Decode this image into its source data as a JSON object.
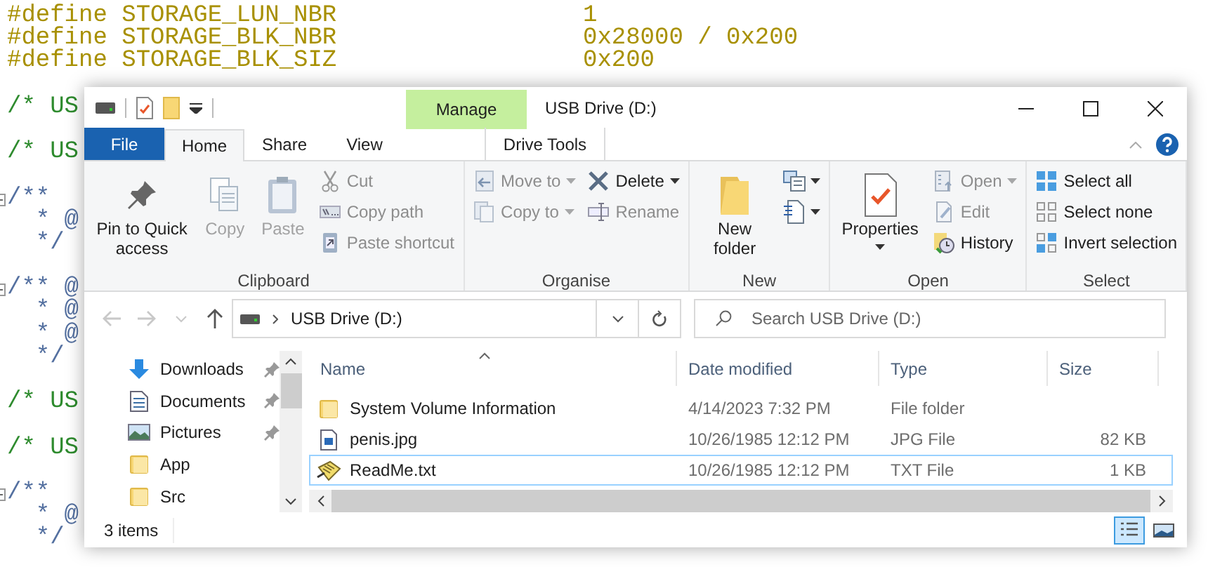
{
  "editor": {
    "lines": [
      {
        "kind": "define",
        "text": "#define STORAGE_LUN_NBR",
        "value": "1"
      },
      {
        "kind": "define",
        "text": "#define STORAGE_BLK_NBR",
        "value": "0x28000 / 0x200"
      },
      {
        "kind": "define",
        "text": "#define STORAGE_BLK_SIZ",
        "value": "0x200"
      },
      {
        "kind": "blank"
      },
      {
        "kind": "comment",
        "text": "/* US"
      },
      {
        "kind": "blank"
      },
      {
        "kind": "comment",
        "text": "/* US"
      },
      {
        "kind": "blank"
      },
      {
        "kind": "doc",
        "text": "/**",
        "fold": true
      },
      {
        "kind": "doc",
        "text": "  * @",
        "fold": false
      },
      {
        "kind": "doc",
        "text": "  */",
        "fold": false
      },
      {
        "kind": "blank"
      },
      {
        "kind": "doc",
        "text": "/** @",
        "fold": true
      },
      {
        "kind": "doc",
        "text": "  * @",
        "fold": false
      },
      {
        "kind": "doc",
        "text": "  * @",
        "fold": false
      },
      {
        "kind": "doc",
        "text": "  */",
        "fold": false
      },
      {
        "kind": "blank"
      },
      {
        "kind": "comment",
        "text": "/* US"
      },
      {
        "kind": "blank"
      },
      {
        "kind": "comment",
        "text": "/* US"
      },
      {
        "kind": "blank"
      },
      {
        "kind": "doc",
        "text": "/**",
        "fold": true
      },
      {
        "kind": "doc",
        "text": "  * @",
        "fold": false
      },
      {
        "kind": "doc",
        "text": "  */",
        "fold": false
      }
    ]
  },
  "window": {
    "title": "USB Drive (D:)",
    "context_tab": "Manage"
  },
  "tabs": [
    {
      "label": "File",
      "kind": "file",
      "selected": false
    },
    {
      "label": "Home",
      "kind": "tab",
      "selected": true
    },
    {
      "label": "Share",
      "kind": "tab",
      "selected": false
    },
    {
      "label": "View",
      "kind": "tab",
      "selected": false
    },
    {
      "label": "Drive Tools",
      "kind": "context",
      "selected": false
    }
  ],
  "ribbon": {
    "groups": [
      {
        "label": "Clipboard",
        "columns": [
          [
            {
              "kind": "large",
              "label": "Pin to Quick access",
              "disabled": false
            }
          ],
          [
            {
              "kind": "large",
              "label": "Copy",
              "disabled": true
            }
          ],
          [
            {
              "kind": "large",
              "label": "Paste",
              "disabled": true
            }
          ],
          [
            {
              "kind": "small",
              "label": "Cut",
              "disabled": true
            },
            {
              "kind": "small",
              "label": "Copy path",
              "disabled": true
            },
            {
              "kind": "small",
              "label": "Paste shortcut",
              "disabled": true
            }
          ]
        ]
      },
      {
        "label": "Organise",
        "columns": [
          [
            {
              "kind": "small",
              "label": "Move to",
              "disabled": true,
              "dropdown": true
            },
            {
              "kind": "small",
              "label": "Copy to",
              "disabled": true,
              "dropdown": true
            }
          ],
          [
            {
              "kind": "small",
              "label": "Delete",
              "disabled": false,
              "dropdown": true
            },
            {
              "kind": "small",
              "label": "Rename",
              "disabled": true
            }
          ]
        ]
      },
      {
        "label": "New",
        "columns": [
          [
            {
              "kind": "large",
              "label": "New folder",
              "disabled": false
            }
          ],
          [
            {
              "kind": "icon",
              "disabled": false,
              "dropdown": true
            },
            {
              "kind": "icon",
              "disabled": false,
              "dropdown": true
            }
          ]
        ]
      },
      {
        "label": "Open",
        "columns": [
          [
            {
              "kind": "large",
              "label": "Properties",
              "disabled": false,
              "dropdown": true
            }
          ],
          [
            {
              "kind": "small",
              "label": "Open",
              "disabled": true,
              "dropdown": true
            },
            {
              "kind": "small",
              "label": "Edit",
              "disabled": true
            },
            {
              "kind": "small",
              "label": "History",
              "disabled": false
            }
          ]
        ]
      },
      {
        "label": "Select",
        "columns": [
          [
            {
              "kind": "small",
              "label": "Select all",
              "disabled": false
            },
            {
              "kind": "small",
              "label": "Select none",
              "disabled": false
            },
            {
              "kind": "small",
              "label": "Invert selection",
              "disabled": false
            }
          ]
        ]
      }
    ]
  },
  "nav_buttons": [
    {
      "kind": "back",
      "disabled": true
    },
    {
      "kind": "forward",
      "disabled": true
    },
    {
      "kind": "recent",
      "disabled": true
    },
    {
      "kind": "up",
      "disabled": false
    }
  ],
  "address": {
    "path": "USB Drive (D:)"
  },
  "search": {
    "placeholder": "Search USB Drive (D:)"
  },
  "sidebar": {
    "items": [
      {
        "label": "Downloads",
        "kind": "downloads",
        "pinned": true
      },
      {
        "label": "Documents",
        "kind": "documents",
        "pinned": true
      },
      {
        "label": "Pictures",
        "kind": "pictures",
        "pinned": true
      },
      {
        "label": "App",
        "kind": "folder",
        "pinned": false
      },
      {
        "label": "Src",
        "kind": "folder",
        "pinned": false
      }
    ]
  },
  "table": {
    "columns": [
      "Name",
      "Date modified",
      "Type",
      "Size"
    ],
    "rows": [
      {
        "kind": "folder",
        "name": "System Volume Information",
        "date": "4/14/2023 7:32 PM",
        "type": "File folder",
        "selected": false
      },
      {
        "kind": "image",
        "name": "penis.jpg",
        "date": "10/26/1985 12:12 PM",
        "type": "JPG File",
        "size": "82 KB",
        "selected": false
      },
      {
        "kind": "text",
        "name": "ReadMe.txt",
        "date": "10/26/1985 12:12 PM",
        "type": "TXT File",
        "size": "1 KB",
        "selected": true
      }
    ]
  },
  "status_bar": {
    "count": "3 items",
    "views": [
      {
        "kind": "details",
        "selected": true
      },
      {
        "kind": "thumbs",
        "selected": false
      }
    ]
  }
}
